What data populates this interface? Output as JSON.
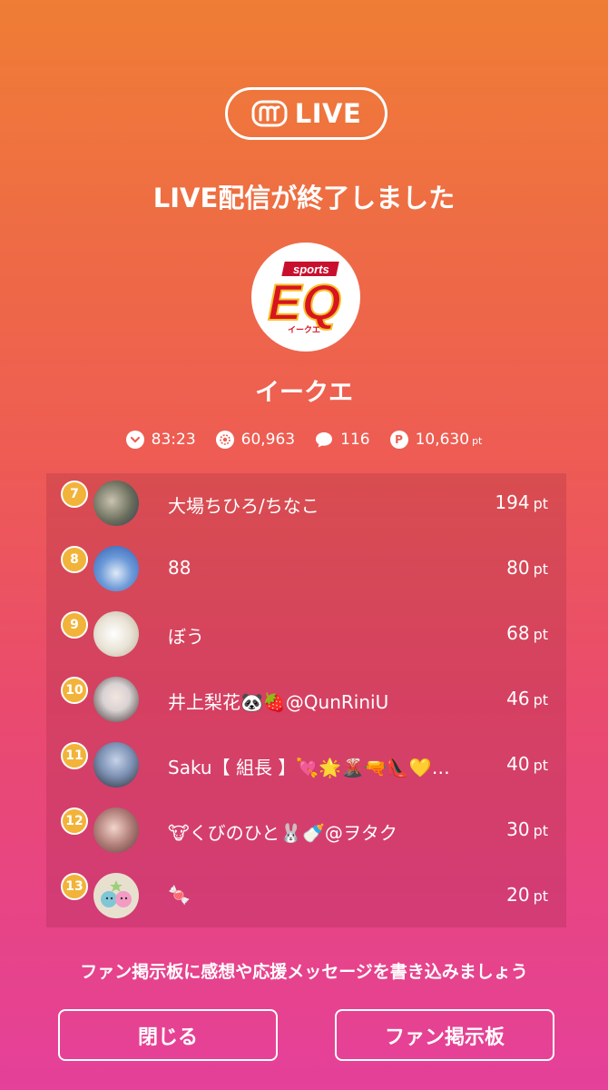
{
  "header": {
    "live_label": "LIVE",
    "title": "LIVE配信が終了しました"
  },
  "streamer": {
    "name": "イークエ",
    "logo_text": "EQ",
    "logo_sub": "sports",
    "logo_caption": "イークエ"
  },
  "stats": {
    "duration": "83:23",
    "viewers": "60,963",
    "comments": "116",
    "points": "10,630",
    "points_unit": "pt"
  },
  "ranking": [
    {
      "rank": "7",
      "name": "大場ちひろ/ちなこ",
      "points": "194",
      "unit": "pt",
      "avatar_color": "#6b6e5c"
    },
    {
      "rank": "8",
      "name": "88",
      "points": "80",
      "unit": "pt",
      "avatar_color": "#3e6fbf"
    },
    {
      "rank": "9",
      "name": "ぼう",
      "points": "68",
      "unit": "pt",
      "avatar_color": "#e9e3d6"
    },
    {
      "rank": "10",
      "name": "井上梨花🐼🍓@QunRiniU",
      "points": "46",
      "unit": "pt",
      "avatar_color": "#d9d2d3"
    },
    {
      "rank": "11",
      "name": "Saku【 組長 】💘🌟🌋🔫👠💛…",
      "points": "40",
      "unit": "pt",
      "avatar_color": "#7f93b6"
    },
    {
      "rank": "12",
      "name": "🐮くびのひと🐰🍼@ヲタク",
      "points": "30",
      "unit": "pt",
      "avatar_color": "#b07d78"
    },
    {
      "rank": "13",
      "name": "🍬",
      "points": "20",
      "unit": "pt",
      "avatar_color": "#e8e0cf"
    }
  ],
  "footer": {
    "prompt": "ファン掲示板に感想や応援メッセージを書き込みましょう",
    "close_label": "閉じる",
    "board_label": "ファン掲示板"
  },
  "colors": {
    "gradient_top": "#ef7d35",
    "gradient_bottom": "#e5409a",
    "rank_badge": "#f2b33a"
  }
}
